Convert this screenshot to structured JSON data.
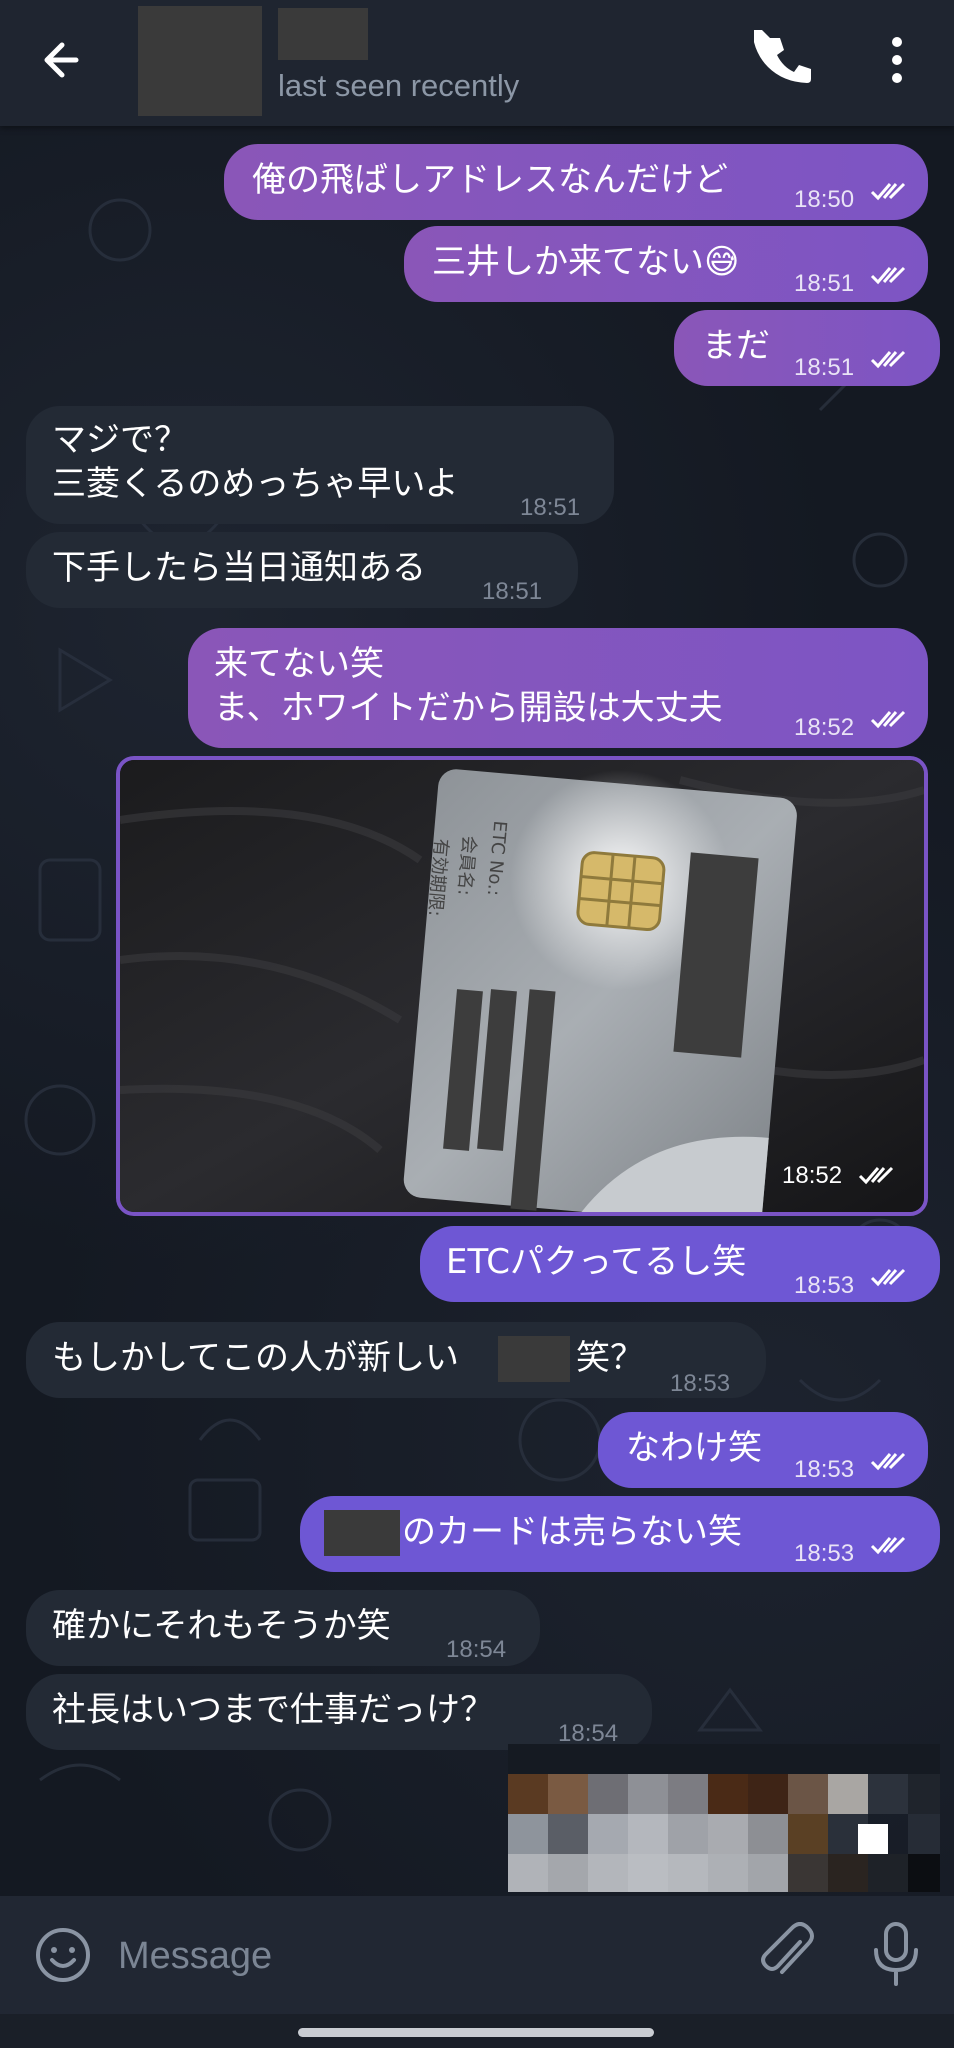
{
  "header": {
    "status": "last seen recently"
  },
  "messages": [
    {
      "dir": "out",
      "text": "俺の飛ばしアドレスなんだけど",
      "time": "18:50"
    },
    {
      "dir": "out",
      "text": "三井しか来てない😅",
      "time": "18:51"
    },
    {
      "dir": "out",
      "text": "まだ",
      "time": "18:51"
    },
    {
      "dir": "in",
      "line1": "マジで？",
      "line2": "三菱くるのめっちゃ早いよ",
      "time": "18:51"
    },
    {
      "dir": "in",
      "text": "下手したら当日通知ある",
      "time": "18:51"
    },
    {
      "dir": "out",
      "line1": "来てない笑",
      "line2": "ま、ホワイトだから開設は大丈夫",
      "time": "18:52"
    },
    {
      "dir": "out",
      "type": "photo",
      "time": "18:52",
      "card_labels": [
        "ETC No.:",
        "会員名:",
        "有効期限:"
      ]
    },
    {
      "dir": "out",
      "text": "ETCパクってるし笑",
      "time": "18:53"
    },
    {
      "dir": "in",
      "text_before": "もしかしてこの人が新しい",
      "text_after": "笑？",
      "time": "18:53"
    },
    {
      "dir": "out",
      "text": "なわけ笑",
      "time": "18:53"
    },
    {
      "dir": "out",
      "text_after": "のカードは売らない笑",
      "time": "18:53"
    },
    {
      "dir": "in",
      "text": "確かにそれもそうか笑",
      "time": "18:54"
    },
    {
      "dir": "in",
      "text": "社長はいつまで仕事だっけ？",
      "time": "18:54"
    }
  ],
  "composer": {
    "placeholder": "Message"
  },
  "icons": [
    "back-arrow-icon",
    "phone-icon",
    "more-vertical-icon",
    "emoji-icon",
    "paperclip-icon",
    "microphone-icon",
    "double-check-icon"
  ],
  "colors": {
    "outgoing_bubble": "#8a56b8",
    "outgoing_bubble_alt": "#6e57d4",
    "incoming_bubble": "#232a35",
    "header": "#1f2530",
    "background": "#141922"
  }
}
